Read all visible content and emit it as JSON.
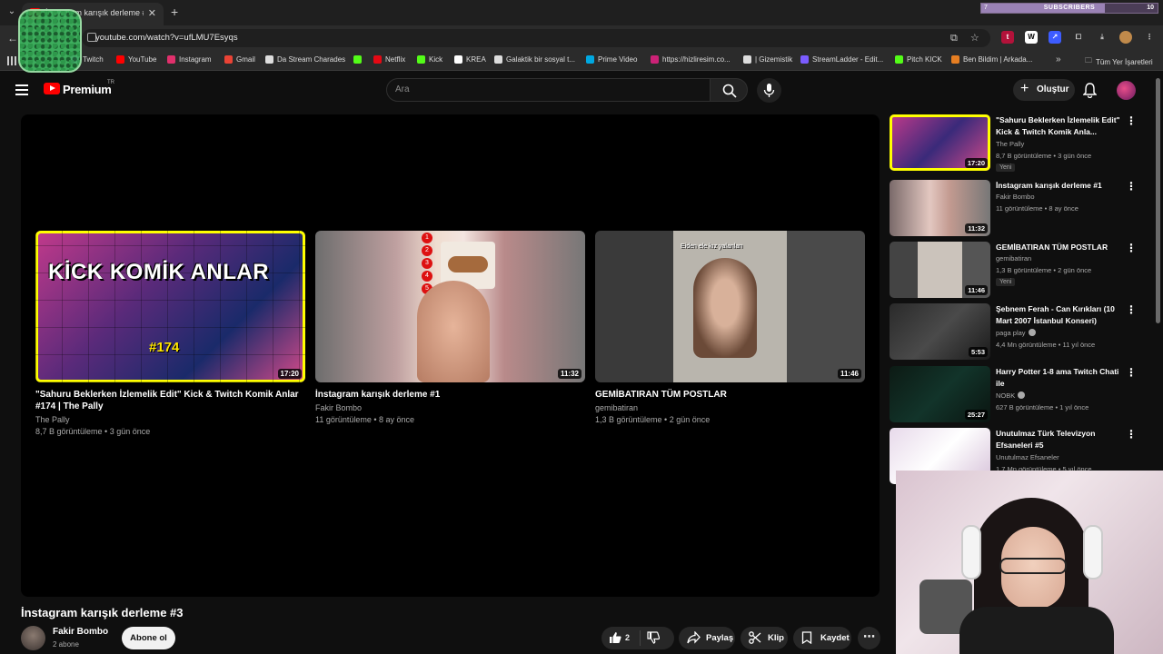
{
  "browser": {
    "tab_title": "İnstagram karışık derleme #3 -",
    "url": "youtube.com/watch?v=ufLMU7Esyqs",
    "subs_widget": {
      "label": "SUBSCRIBERS",
      "current": "7",
      "goal": "10",
      "progress": 0.7
    }
  },
  "bookmarks": [
    {
      "label": "Twitch",
      "icon": "twitch-icon",
      "color": "#9146ff"
    },
    {
      "label": "YouTube",
      "icon": "youtube-icon",
      "color": "#ff0000"
    },
    {
      "label": "Instagram",
      "icon": "instagram-icon",
      "color": "#e1306c"
    },
    {
      "label": "Gmail",
      "icon": "gmail-icon",
      "color": "#ea4335"
    },
    {
      "label": "Da Stream Charades",
      "icon": "bookmark-icon",
      "color": "#dddddd"
    },
    {
      "label": "",
      "icon": "kick-icon",
      "color": "#53fc18"
    },
    {
      "label": "Netflix",
      "icon": "netflix-icon",
      "color": "#e50914"
    },
    {
      "label": "Kick",
      "icon": "kick-icon",
      "color": "#53fc18"
    },
    {
      "label": "KREA",
      "icon": "krea-icon",
      "color": "#ffffff"
    },
    {
      "label": "Galaktik bir sosyal t...",
      "icon": "zk-icon",
      "color": "#dddddd"
    },
    {
      "label": "Prime Video",
      "icon": "prime-icon",
      "color": "#00a8e1"
    },
    {
      "label": "https://hizliresim.co...",
      "icon": "hizliresim-icon",
      "color": "#cc2277"
    },
    {
      "label": "| Gizemistik",
      "icon": "g-icon",
      "color": "#dddddd"
    },
    {
      "label": "StreamLadder - Edit...",
      "icon": "sl-icon",
      "color": "#7b5cff"
    },
    {
      "label": "Pitch KICK",
      "icon": "kick-icon",
      "color": "#53fc18"
    },
    {
      "label": "Ben Bildim | Arkada...",
      "icon": "benbildim-icon",
      "color": "#e67e22"
    }
  ],
  "bookmarks_all": "Tüm Yer İşaretleri",
  "header": {
    "brand": "Premium",
    "region": "TR",
    "search_placeholder": "Ara",
    "create_label": "Oluştur"
  },
  "endscreen": [
    {
      "title": "\"Sahuru Beklerken İzlemelik Edit\" Kick & Twitch Komik Anlar #174 | The Pally",
      "channel": "The Pally",
      "meta": "8,7 B görüntüleme • 3 gün önce",
      "duration": "17:20",
      "thumb_text": "KİCK KOMİK ANLAR",
      "thumb_num": "#174"
    },
    {
      "title": "İnstagram karışık derleme #1",
      "channel": "Fakir Bombo",
      "meta": "11 görüntüleme • 8 ay önce",
      "duration": "11:32"
    },
    {
      "title": "GEMİBATIRAN TÜM POSTLAR",
      "channel": "gemibatiran",
      "meta": "1,3 B görüntüleme • 2 gün önce",
      "duration": "11:46",
      "thumb_text": "Eiden ele kız yalanları"
    }
  ],
  "video": {
    "title": "İnstagram karışık derleme #3",
    "channel": "Fakir Bombo",
    "subs": "2 abone",
    "subscribe_label": "Abone ol",
    "likes": "2",
    "share_label": "Paylaş",
    "clip_label": "Klip",
    "save_label": "Kaydet"
  },
  "sidebar": [
    {
      "title": "\"Sahuru Beklerken İzlemelik Edit\" Kick & Twitch Komik Anla...",
      "channel": "The Pally",
      "meta": "8,7 B görüntüleme • 3 gün önce",
      "badge": "Yeni",
      "duration": "17:20",
      "thumb_text": "KİCK KOMİK ANLAR"
    },
    {
      "title": "İnstagram karışık derleme #1",
      "channel": "Fakir Bombo",
      "meta": "11 görüntüleme • 8 ay önce",
      "duration": "11:32"
    },
    {
      "title": "GEMİBATIRAN TÜM POSTLAR",
      "channel": "gemibatiran",
      "meta": "1,3 B görüntüleme • 2 gün önce",
      "badge": "Yeni",
      "duration": "11:46"
    },
    {
      "title": "Şebnem Ferah - Can Kırıkları (10 Mart 2007 İstanbul Konseri)",
      "channel": "paga play",
      "meta": "4,4 Mn görüntüleme • 11 yıl önce",
      "duration": "5:53",
      "verified": true
    },
    {
      "title": "Harry Potter 1-8 ama Twitch Chati ile",
      "channel": "NOBK",
      "meta": "627 B görüntüleme • 1 yıl önce",
      "duration": "25:27",
      "verified": true
    },
    {
      "title": "Unutulmaz Türk Televizyon Efsaneleri #5",
      "channel": "Unutulmaz Efsaneler",
      "meta": "1,7 Mn görüntüleme • 5 yıl önce",
      "duration": ""
    }
  ]
}
